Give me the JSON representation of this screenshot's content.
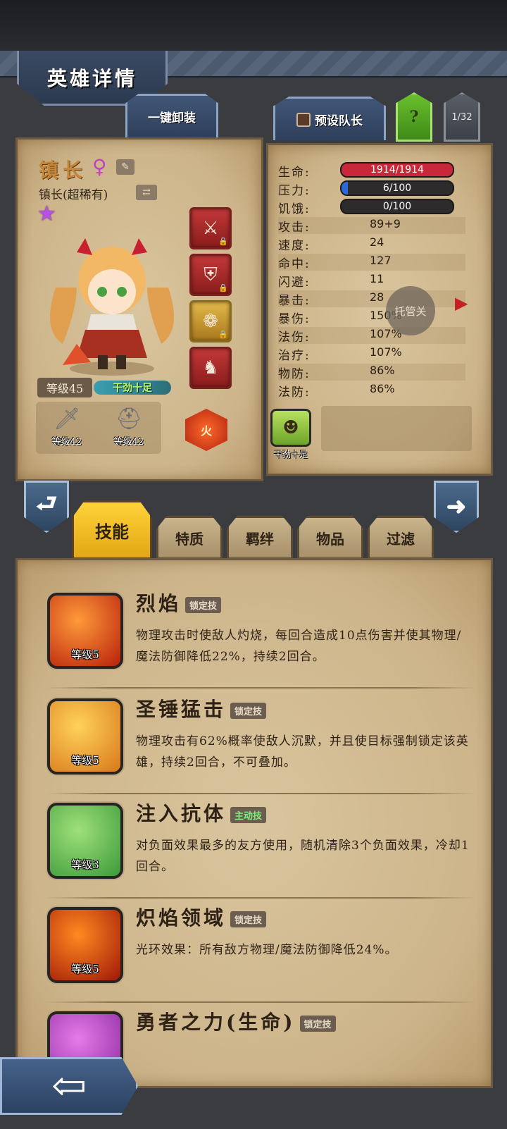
{
  "header": {
    "title": "英雄详情"
  },
  "toolbar": {
    "unequip_all": "一键卸装",
    "preset_captain": "预设队长",
    "help": "?",
    "hero_count": "1/32"
  },
  "hero": {
    "name": "镇长",
    "gender_symbol": "♀",
    "class_label": "镇长(超稀有)",
    "rarity_stars": 1,
    "level_label": "等级45",
    "status": "干劲十足",
    "element": "火",
    "equipment": [
      {
        "icon": "sword-icon",
        "level_label": "等级42"
      },
      {
        "icon": "helmet-icon",
        "level_label": "等级42"
      }
    ]
  },
  "stats": {
    "hp": {
      "label": "生命:",
      "value": "1914/1914",
      "fraction": 1.0,
      "color": "#c8283a"
    },
    "stress": {
      "label": "压力:",
      "value": "6/100",
      "fraction": 0.06,
      "color": "#2a6ad8"
    },
    "hunger": {
      "label": "饥饿:",
      "value": "0/100",
      "fraction": 0.0,
      "color": "#e0a020"
    },
    "rows": [
      {
        "label": "攻击:",
        "value": "89+9"
      },
      {
        "label": "速度:",
        "value": "24"
      },
      {
        "label": "命中:",
        "value": "127"
      },
      {
        "label": "闪避:",
        "value": "11"
      },
      {
        "label": "暴击:",
        "value": "28"
      },
      {
        "label": "暴伤:",
        "value": "150%"
      },
      {
        "label": "法伤:",
        "value": "107%"
      },
      {
        "label": "治疗:",
        "value": "107%"
      },
      {
        "label": "物防:",
        "value": "86%"
      },
      {
        "label": "法防:",
        "value": "86%"
      }
    ]
  },
  "managed_toggle": "托管关",
  "trait": {
    "label": "干劲十足"
  },
  "tabs": [
    {
      "label": "技能",
      "active": true
    },
    {
      "label": "特质",
      "active": false
    },
    {
      "label": "羁绊",
      "active": false
    },
    {
      "label": "物品",
      "active": false
    },
    {
      "label": "过滤",
      "active": false
    }
  ],
  "skills": [
    {
      "name": "烈焰",
      "type": "锁定技",
      "level": "等级5",
      "desc": "物理攻击时使敌人灼烧，每回合造成10点伤害并使其物理/魔法防御降低22%，持续2回合。",
      "icon_colors": [
        "#ff9a3a",
        "#b8200c"
      ]
    },
    {
      "name": "圣锤猛击",
      "type": "锁定技",
      "level": "等级5",
      "desc": "物理攻击有62%概率使敌人沉默，并且使目标强制锁定该英雄，持续2回合，不可叠加。",
      "icon_colors": [
        "#ffd25a",
        "#d8781a"
      ]
    },
    {
      "name": "注入抗体",
      "type": "主动技",
      "level": "等级3",
      "desc": "对负面效果最多的友方使用，随机清除3个负面效果，冷却1回合。",
      "icon_colors": [
        "#9fe07a",
        "#3c9a3a"
      ]
    },
    {
      "name": "炽焰领域",
      "type": "锁定技",
      "level": "等级5",
      "desc": "光环效果：所有敌方物理/魔法防御降低24%。",
      "icon_colors": [
        "#ff8a20",
        "#a01808"
      ]
    },
    {
      "name": "勇者之力(生命)",
      "type": "锁定技",
      "level": "",
      "desc": "",
      "icon_colors": [
        "#e67ae8",
        "#8a2aa0"
      ]
    }
  ]
}
